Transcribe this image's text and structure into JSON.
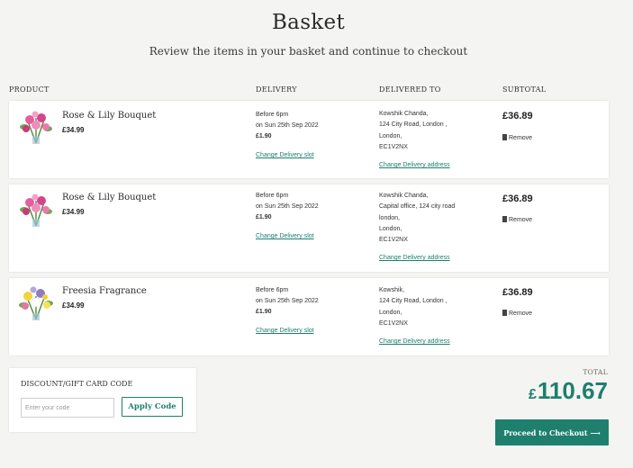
{
  "page": {
    "title": "Basket",
    "subtitle": "Review the items in your basket and continue to checkout"
  },
  "columns": {
    "product": "PRODUCT",
    "delivery": "DELIVERY",
    "delivered_to": "DELIVERED TO",
    "subtotal": "SUBTOTAL"
  },
  "items": [
    {
      "name": "Rose & Lily Bouquet",
      "price": "£34.99",
      "image_icon": "pink-bouquet-image",
      "delivery_time": "Before 6pm",
      "delivery_date": "on Sun 25th Sep 2022",
      "delivery_fee": "£1.90",
      "change_slot": "Change Delivery slot",
      "address_lines": [
        "Kowshik Chanda,",
        "124 City Road, London ,",
        "London,",
        "EC1V2NX"
      ],
      "change_address": "Change Delivery address",
      "subtotal": "£36.89",
      "remove": "Remove"
    },
    {
      "name": "Rose & Lily Bouquet",
      "price": "£34.99",
      "image_icon": "pink-bouquet-image",
      "delivery_time": "Before 6pm",
      "delivery_date": "on Sun 25th Sep 2022",
      "delivery_fee": "£1.90",
      "change_slot": "Change Delivery slot",
      "address_lines": [
        "Kowshik Chanda,",
        "Capital office, 124 city road",
        "london,",
        "London,",
        "EC1V2NX"
      ],
      "change_address": "Change Delivery address",
      "subtotal": "£36.89",
      "remove": "Remove"
    },
    {
      "name": "Freesia Fragrance",
      "price": "£34.99",
      "image_icon": "freesia-bouquet-image",
      "delivery_time": "Before 6pm",
      "delivery_date": "on Sun 25th Sep 2022",
      "delivery_fee": "£1.90",
      "change_slot": "Change Delivery slot",
      "address_lines": [
        "Kowshik,",
        "124 City Road, London ,",
        "London,",
        "EC1V2NX"
      ],
      "change_address": "Change Delivery address",
      "subtotal": "£36.89",
      "remove": "Remove"
    }
  ],
  "discount": {
    "label": "DISCOUNT/GIFT CARD CODE",
    "placeholder": "Enter your code",
    "value": "",
    "apply_label": "Apply Code"
  },
  "summary": {
    "total_label": "TOTAL",
    "currency": "£",
    "total_value": "110.67",
    "checkout_label": "Proceed to Checkout ⟶"
  },
  "colors": {
    "accent": "#1e7f6e",
    "background": "#f4f4f2"
  }
}
